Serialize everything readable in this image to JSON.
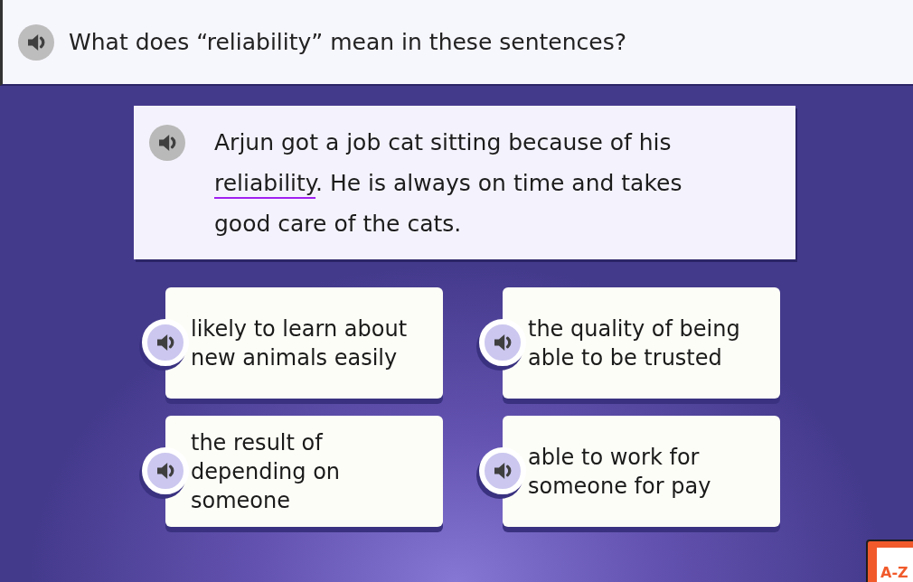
{
  "header": {
    "question": "What does “reliability” mean in these sentences?"
  },
  "passage": {
    "text_before": "Arjun got a job cat sitting because of his ",
    "vocabulary_word": "reliability",
    "text_after": ". He is always on time and takes good care of the cats."
  },
  "answers": [
    {
      "text": "likely to learn about new animals easily"
    },
    {
      "text": "the quality of being able to be trusted"
    },
    {
      "text": "the result of depending on someone"
    },
    {
      "text": "able to work for someone for pay"
    }
  ],
  "glossary_button": {
    "label": "A-Z"
  }
}
